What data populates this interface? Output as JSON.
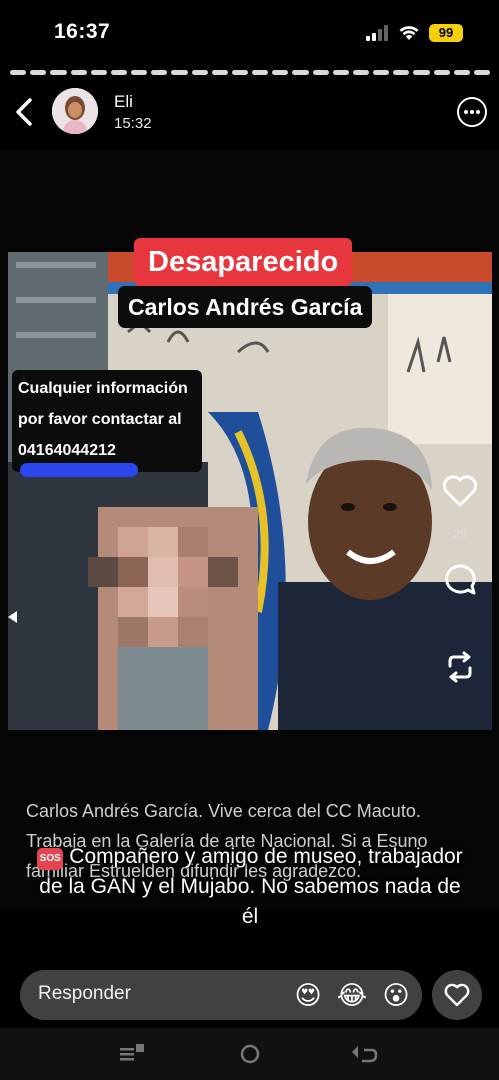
{
  "status_bar": {
    "time": "16:37",
    "battery": "99"
  },
  "header": {
    "user_name": "Eli",
    "post_time": "15:32"
  },
  "story": {
    "tag_title": "Desaparecido",
    "tag_name": "Carlos Andrés García",
    "info_lines": [
      "Cualquier información",
      "por favor contactar al",
      "04164044212"
    ],
    "like_count": "29",
    "caption": "Carlos Andrés García. Vive cerca del CC Macuto. Trabaja en la Galería de arte Nacional. Si a Esuno familiar Estruelden difundir les agradezco.",
    "overlay_text": "Compañero y amigo de museo, trabajador de la GAN y el Mujabo. No sabemos nada de él",
    "sos_label": "SOS"
  },
  "reply": {
    "placeholder": "Responder",
    "reactions": [
      "😍",
      "😂",
      "😮"
    ]
  },
  "icons": {
    "back": "chevron-left-icon",
    "more": "more-options-icon",
    "like": "heart-icon",
    "comment": "comment-bubble-icon",
    "share": "repost-icon",
    "heart_reply": "heart-icon"
  },
  "colors": {
    "accent_red": "#e8363e",
    "redaction_blue": "#2b46ef",
    "battery_yellow": "#f5cf0a"
  }
}
